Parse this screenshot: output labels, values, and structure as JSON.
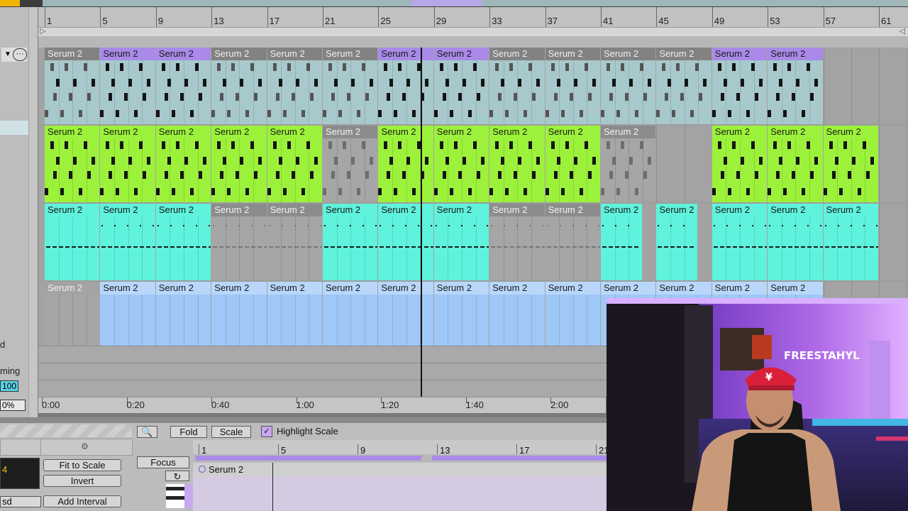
{
  "ruler": {
    "bar_numbers": [
      "1",
      "5",
      "9",
      "13",
      "17",
      "21",
      "25",
      "29",
      "33",
      "37",
      "41",
      "45",
      "49",
      "53",
      "57",
      "61"
    ]
  },
  "left_panel": {
    "label_groove": "ming",
    "value_amount": "100",
    "value_percent": "0%",
    "letter_d": "d"
  },
  "tracks": [
    {
      "name": "Serum 2",
      "color_active": "#a8c9cc",
      "header_active": "#7f7f7f",
      "clips": [
        {
          "bar": 1,
          "active": true,
          "alt": false
        },
        {
          "bar": 5,
          "active": true,
          "alt": true
        },
        {
          "bar": 9,
          "active": true,
          "alt": true
        },
        {
          "bar": 13,
          "active": true,
          "alt": false
        },
        {
          "bar": 17,
          "active": true,
          "alt": false
        },
        {
          "bar": 21,
          "active": true,
          "alt": false
        },
        {
          "bar": 25,
          "active": true,
          "alt": true
        },
        {
          "bar": 29,
          "active": true,
          "alt": true
        },
        {
          "bar": 33,
          "active": true,
          "alt": false
        },
        {
          "bar": 37,
          "active": true,
          "alt": false
        },
        {
          "bar": 41,
          "active": true,
          "alt": false
        },
        {
          "bar": 45,
          "active": true,
          "alt": false
        },
        {
          "bar": 49,
          "active": true,
          "alt": true
        },
        {
          "bar": 53,
          "active": true,
          "alt": true
        }
      ]
    },
    {
      "name": "Serum 2",
      "color_active": "#9cf23a",
      "clips": [
        {
          "bar": 1,
          "active": true
        },
        {
          "bar": 5,
          "active": true
        },
        {
          "bar": 9,
          "active": true
        },
        {
          "bar": 13,
          "active": true
        },
        {
          "bar": 17,
          "active": true
        },
        {
          "bar": 21,
          "active": false
        },
        {
          "bar": 25,
          "active": true
        },
        {
          "bar": 29,
          "active": true
        },
        {
          "bar": 33,
          "active": true
        },
        {
          "bar": 37,
          "active": true
        },
        {
          "bar": 41,
          "active": false
        },
        {
          "bar": 49,
          "active": true
        },
        {
          "bar": 53,
          "active": true
        },
        {
          "bar": 57,
          "active": true
        }
      ]
    },
    {
      "name": "Serum 2",
      "color_active": "#5ff2dc",
      "clips": [
        {
          "bar": 1,
          "active": true
        },
        {
          "bar": 5,
          "active": true
        },
        {
          "bar": 9,
          "active": true
        },
        {
          "bar": 13,
          "active": false
        },
        {
          "bar": 17,
          "active": false
        },
        {
          "bar": 21,
          "active": true
        },
        {
          "bar": 25,
          "active": true
        },
        {
          "bar": 29,
          "active": true
        },
        {
          "bar": 33,
          "active": false
        },
        {
          "bar": 37,
          "active": false
        },
        {
          "bar": 41,
          "active": true,
          "short": true
        },
        {
          "bar": 45,
          "active": true,
          "short": true
        },
        {
          "bar": 49,
          "active": true
        },
        {
          "bar": 53,
          "active": true
        },
        {
          "bar": 57,
          "active": true
        }
      ]
    },
    {
      "name": "Serum 2",
      "color_active": "#9fc8f7",
      "clips": [
        {
          "bar": 1,
          "active": false
        },
        {
          "bar": 5,
          "active": true
        },
        {
          "bar": 9,
          "active": true
        },
        {
          "bar": 13,
          "active": true
        },
        {
          "bar": 17,
          "active": true
        },
        {
          "bar": 21,
          "active": true
        },
        {
          "bar": 25,
          "active": true
        },
        {
          "bar": 29,
          "active": true
        },
        {
          "bar": 33,
          "active": true
        },
        {
          "bar": 37,
          "active": true
        },
        {
          "bar": 41,
          "active": true
        },
        {
          "bar": 45,
          "active": true
        },
        {
          "bar": 49,
          "active": true
        },
        {
          "bar": 53,
          "active": true
        }
      ]
    }
  ],
  "time_ruler": [
    "0:00",
    "0:20",
    "0:40",
    "1:00",
    "1:20",
    "1:40",
    "2:00"
  ],
  "clip_editor": {
    "fold_label": "Fold",
    "scale_label": "Scale",
    "highlight_scale_label": "Highlight Scale",
    "highlight_checked_glyph": "✓",
    "fit_to_scale_label": "Fit to Scale",
    "invert_label": "Invert",
    "add_interval_label": "Add Interval",
    "focus_label": "Focus",
    "clip_name": "Serum 2",
    "left_value": "4",
    "left_value_2": "sd",
    "bar_numbers": [
      "1",
      "5",
      "9",
      "13",
      "17",
      "21"
    ]
  },
  "webcam": {
    "wall_text": "FREESTAHYL"
  }
}
